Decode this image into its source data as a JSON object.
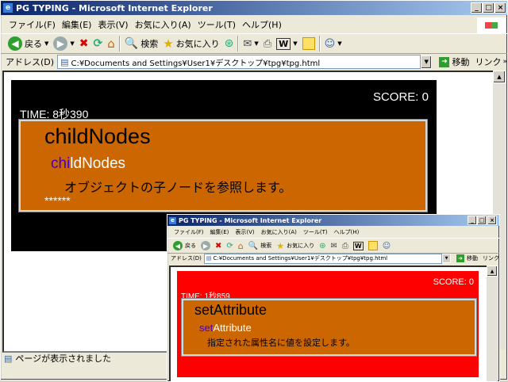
{
  "main_window": {
    "title": "PG TYPING - Microsoft Internet Explorer",
    "menu": [
      "ファイル(F)",
      "編集(E)",
      "表示(V)",
      "お気に入り(A)",
      "ツール(T)",
      "ヘルプ(H)"
    ],
    "toolbar": {
      "back": "戻る",
      "search": "検索",
      "favorites": "お気に入り"
    },
    "address_label": "アドレス(D)",
    "address_value": "C:¥Documents and Settings¥User1¥デスクトップ¥tpg¥tpg.html",
    "go_label": "移動",
    "links_label": "リンク",
    "status_text": "ページが表示されました",
    "page_bg": "#000000",
    "game": {
      "score": "SCORE: 0",
      "time": "TIME: 8秒390",
      "word": "childNodes",
      "typed": "chi",
      "remaining": "ldNodes",
      "description": "オブジェクトの子ノードを参照します。",
      "masked": "******"
    }
  },
  "popup_window": {
    "title": "PG TYPING - Microsoft Internet Explorer",
    "menu": [
      "ファイル(F)",
      "編集(E)",
      "表示(V)",
      "お気に入り(A)",
      "ツール(T)",
      "ヘルプ(H)"
    ],
    "toolbar": {
      "back": "戻る",
      "search": "検索",
      "favorites": "お気に入り"
    },
    "address_label": "アドレス(D)",
    "address_value": "C:¥Documents and Settings¥User1¥デスクトップ¥tpg¥tpg.html",
    "go_label": "移動",
    "links_label": "リンク",
    "page_bg": "#ff0000",
    "game": {
      "score": "SCORE: 0",
      "time": "TIME: 1秒859",
      "word": "setAttribute",
      "typed": "set",
      "remaining": "Attribute",
      "description": "指定された属性名に値を設定します。"
    }
  },
  "colors": {
    "card": "#cc6600",
    "typed": "#4400cc",
    "titlebar": "#0a246a"
  }
}
